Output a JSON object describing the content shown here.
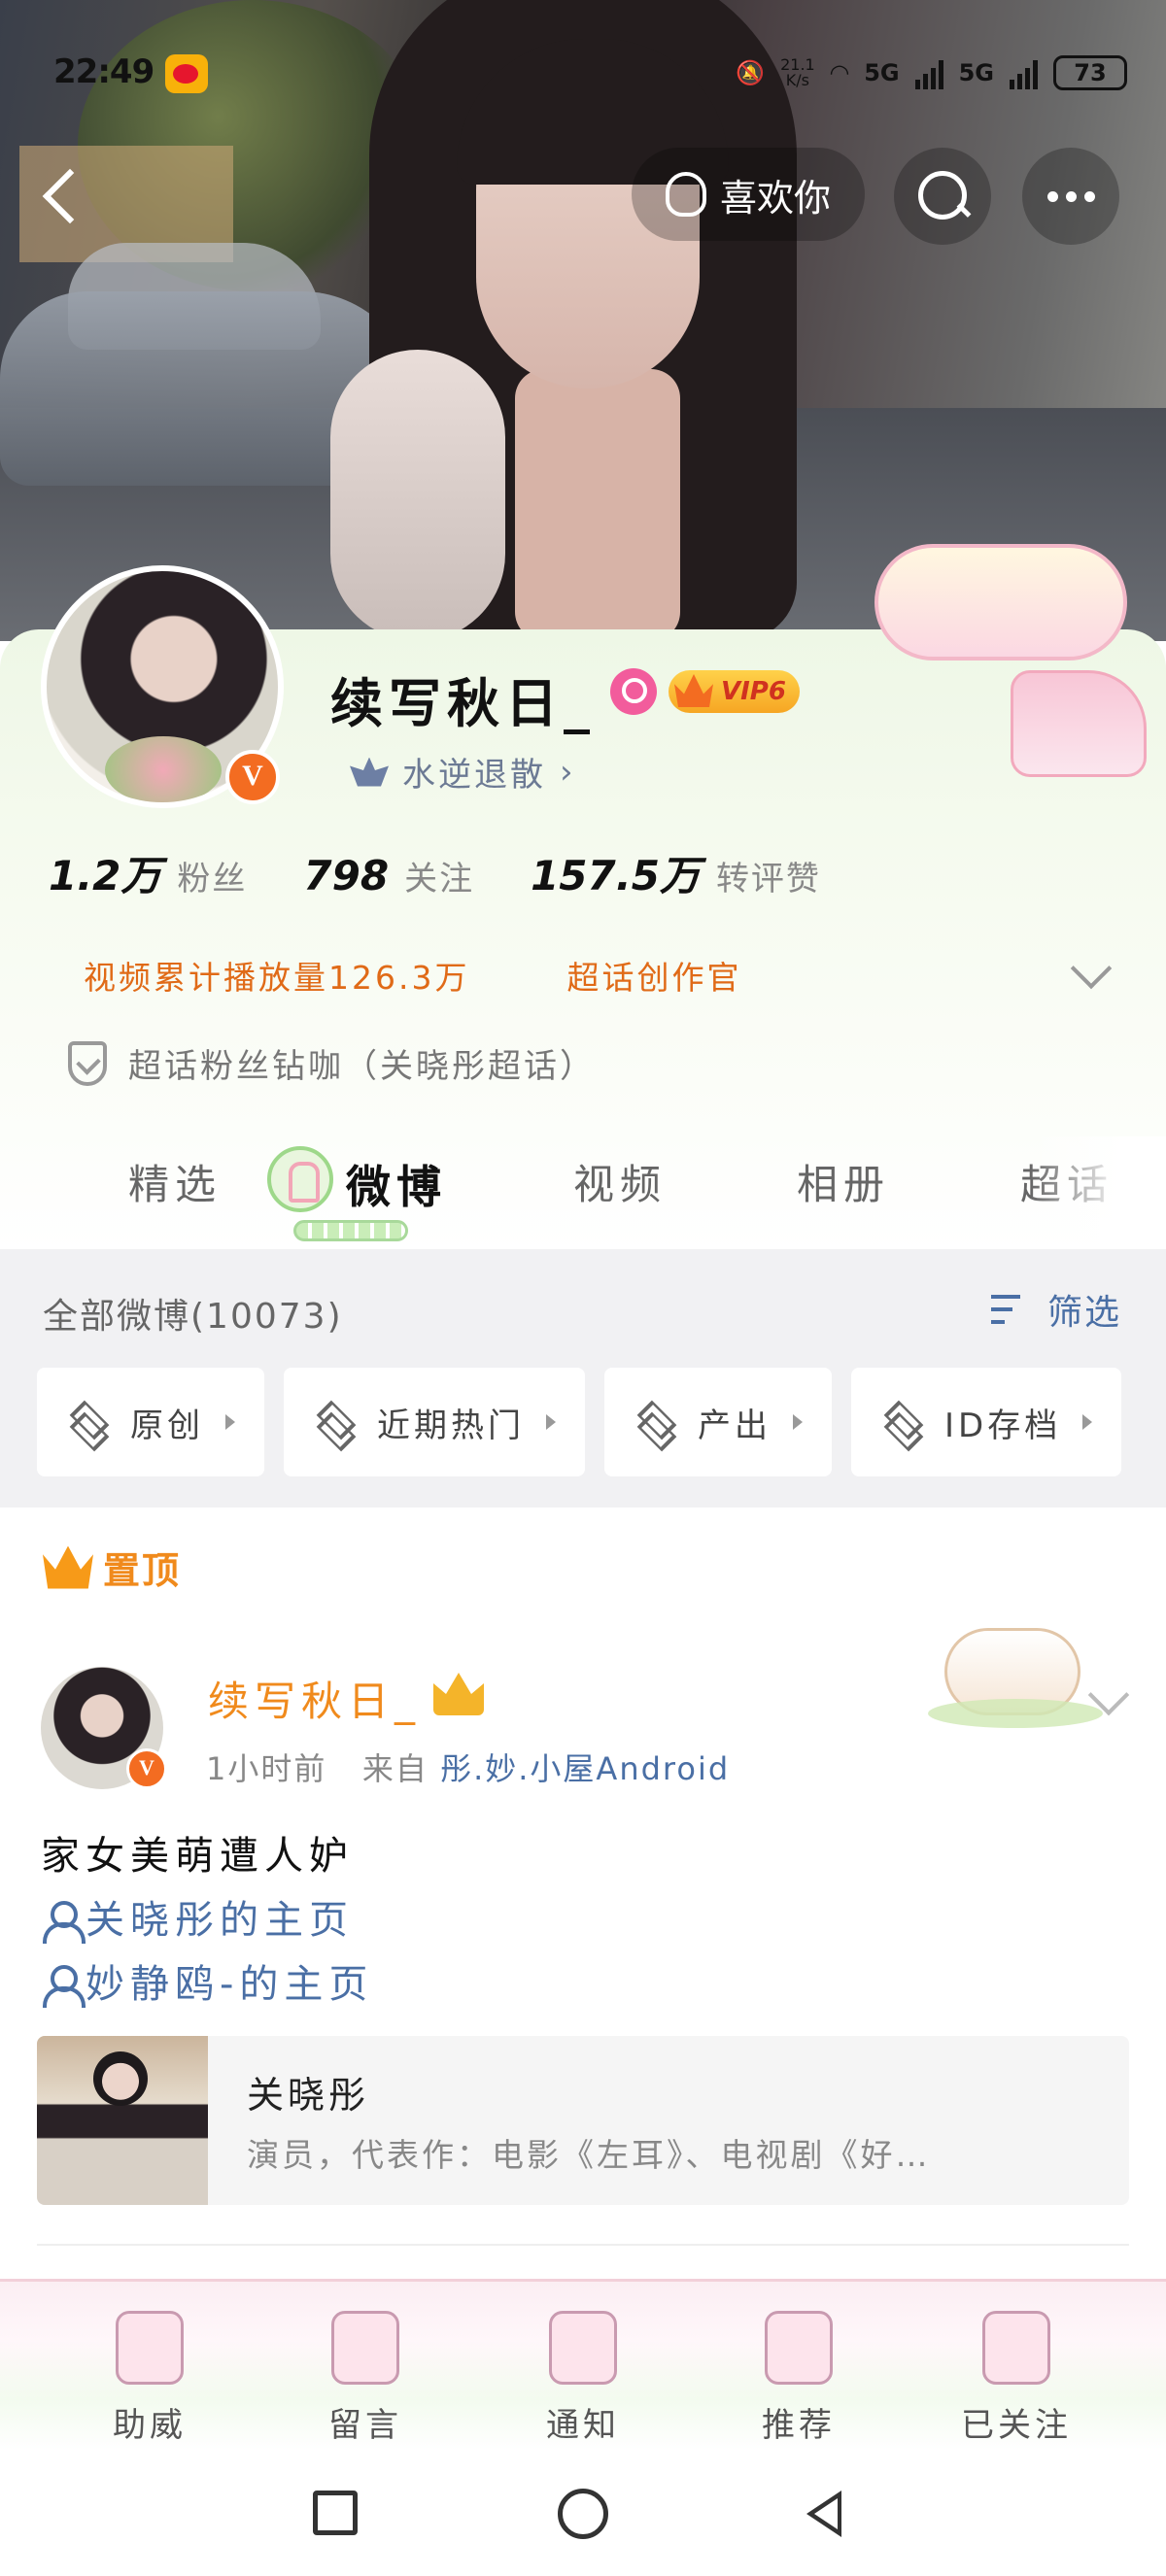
{
  "status_bar": {
    "time": "22:49",
    "net_speed_value": "21.1",
    "net_speed_unit": "K/s",
    "signal1": "5G",
    "signal2": "5G",
    "battery": "73"
  },
  "header": {
    "like_label": "喜欢你"
  },
  "profile": {
    "name": "续写秋日_",
    "vip_level": "VIP6",
    "tag": "水逆退散",
    "stats": [
      {
        "value": "1.2万",
        "label": "粉丝"
      },
      {
        "value": "798",
        "label": "关注"
      },
      {
        "value": "157.5万",
        "label": "转评赞"
      }
    ],
    "honor_video": "视频累计播放量126.3万",
    "honor_creator": "超话创作官",
    "fan_status": "超话粉丝钻咖（关晓彤超话）"
  },
  "tabs": [
    "精选",
    "微博",
    "视频",
    "相册",
    "超话"
  ],
  "active_tab": "微博",
  "feed": {
    "all_count": "全部微博(10073)",
    "filter_label": "筛选",
    "chips": [
      "原创",
      "近期热门",
      "产出",
      "ID存档"
    ]
  },
  "post": {
    "pinned_label": "置顶",
    "author": "续写秋日_",
    "time": "1小时前",
    "from_prefix": "来自",
    "source": "彤.妙.小屋Android",
    "text": "家女美萌遭人妒",
    "links": [
      "关晓彤的主页",
      "妙静鸥-的主页"
    ],
    "card": {
      "title": "关晓彤",
      "desc": "演员，代表作：电影《左耳》、电视剧《好…"
    }
  },
  "bottom_bar": [
    "助威",
    "留言",
    "通知",
    "推荐",
    "已关注"
  ],
  "colors": {
    "accent_orange": "#f08a1c",
    "link_blue": "#4a6fa5",
    "vip_gold": "#f6a623"
  }
}
